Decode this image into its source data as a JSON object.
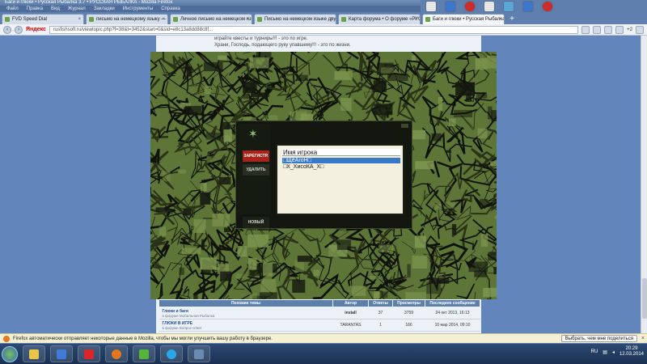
{
  "window": {
    "title": "Баги и глюки • Русская Рыбалка 3.7 • РУССКАЯ РЫБАЛКА - Mozilla Firefox",
    "menu": [
      "Файл",
      "Правка",
      "Вид",
      "Журнал",
      "Закладки",
      "Инструменты",
      "Справка"
    ]
  },
  "tabs": [
    {
      "label": "FVD Speed Dial",
      "active": false
    },
    {
      "label": "письмо на немецкому языку — Янд...",
      "active": false
    },
    {
      "label": "Личное письмо на немецком языке...",
      "active": false
    },
    {
      "label": "Письмо на немецком языке другу |...",
      "active": false
    },
    {
      "label": "Карта форума • О форуме «РУССК...",
      "active": false
    },
    {
      "label": "Баги и глюки • Русская Рыбалка 3.7...",
      "active": true
    }
  ],
  "navbar": {
    "search_brand": "Яндекс",
    "url": "rusfishsoft.ru/viewtopic.php?f=38&t=3452&start=0&sid=e8c13a8dd88c8f...",
    "temperature": "+2"
  },
  "forum_text": {
    "line1": "играйте квесты и турниры!!! - это по игре.",
    "line2": "Храни, Господь, подающего руку упавшему!!! - это по жизни."
  },
  "game_dialog": {
    "btn_add": "ЗАРЕГИСТР.",
    "btn_delete": "УДАЛИТЬ",
    "btn_new": "НОВЫЙ",
    "list_header": "Имя игрока",
    "players": [
      "□ЩёАгоН□",
      "□Х_ХисоКА_Х□"
    ],
    "selected_index": 0
  },
  "topics": {
    "headers": [
      "Похожие темы",
      "Автор",
      "Ответы",
      "Просмотры",
      "Последнее сообщение"
    ],
    "rows": [
      {
        "title": "Глюки и баги",
        "forum": "в форуме Мобильная Рыбалка",
        "author": "install",
        "replies": "37",
        "views": "3759",
        "last": "24 окт 2013, 16:13"
      },
      {
        "title": "ГЛЮКИ В ИГРЕ",
        "forum": "в форуме Вопрос-ответ",
        "author": "TARANTAS",
        "replies": "1",
        "views": "166",
        "last": "10 мар 2014, 09:10"
      }
    ]
  },
  "notification": {
    "text": "Firefox автоматически отправляет некоторые данные в Mozilla, чтобы мы могли улучшить вашу работу в браузере.",
    "button": "Выбрать, чем мне поделиться",
    "close": "×"
  },
  "taskbar": {
    "lang": "RU",
    "time": "20:29",
    "date": "12.03.2014"
  },
  "colors": {
    "page_bg": "#6286bc",
    "accent_red": "#a8231a",
    "selection": "#3679c9"
  }
}
